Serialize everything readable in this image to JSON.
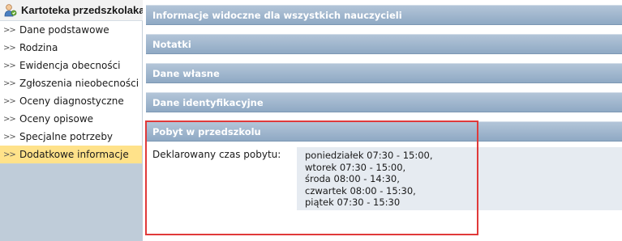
{
  "sidebar": {
    "title": "Kartoteka przedszkolaka",
    "icon": "child-user-icon",
    "chevron": ">>",
    "items": [
      {
        "label": "Dane podstawowe"
      },
      {
        "label": "Rodzina"
      },
      {
        "label": "Ewidencja obecności"
      },
      {
        "label": "Zgłoszenia nieobecności"
      },
      {
        "label": "Oceny diagnostyczne"
      },
      {
        "label": "Oceny opisowe"
      },
      {
        "label": "Specjalne potrzeby"
      },
      {
        "label": "Dodatkowe informacje",
        "active": true
      }
    ]
  },
  "panels": [
    {
      "title": "Informacje widoczne dla wszystkich nauczycieli"
    },
    {
      "title": "Notatki"
    },
    {
      "title": "Dane własne"
    },
    {
      "title": "Dane identyfikacyjne"
    },
    {
      "title": "Pobyt w przedszkolu"
    }
  ],
  "stay": {
    "label": "Deklarowany czas pobytu:",
    "schedule": [
      "poniedziałek 07:30 - 15:00,",
      "wtorek 07:30 - 15:00,",
      "środa 08:00 - 14:30,",
      "czwartek 08:00 - 15:30,",
      "piątek 07:30 - 15:30"
    ]
  },
  "colors": {
    "active_item": "#ffe28a",
    "panel_header": "#9db3cb",
    "highlight": "#e03a3a"
  }
}
